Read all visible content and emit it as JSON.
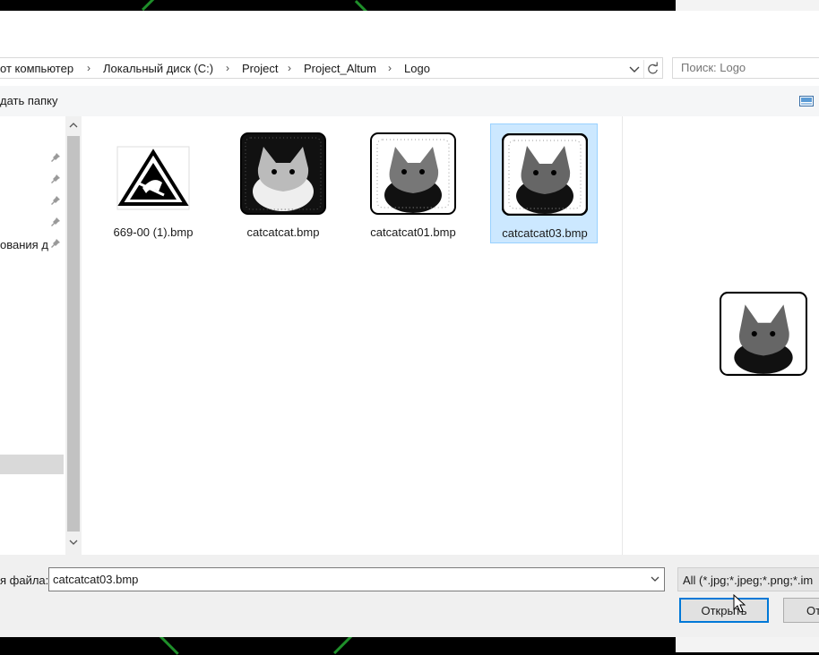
{
  "breadcrumb": {
    "items": [
      "от компьютер",
      "Локальный диск (C:)",
      "Project",
      "Project_Altum",
      "Logo"
    ]
  },
  "search": {
    "placeholder": "Поиск: Logo"
  },
  "toolbar": {
    "new_folder_label": "дать папку"
  },
  "nav": {
    "visible_label": "ования д"
  },
  "files": [
    {
      "name": "669-00 (1).bmp",
      "selected": false
    },
    {
      "name": "catcatcat.bmp",
      "selected": false
    },
    {
      "name": "catcatcat01.bmp",
      "selected": false
    },
    {
      "name": "catcatcat03.bmp",
      "selected": true
    }
  ],
  "footer": {
    "filename_label": "я файла:",
    "filename_value": "catcatcat03.bmp",
    "filter_label": "All (*.jpg;*.jpeg;*.png;*.im",
    "open_button": "Открыть",
    "cancel_button": "От"
  },
  "colors": {
    "accent": "#0078d7",
    "selection_bg": "#cce8ff",
    "selection_border": "#99d1ff",
    "background_line": "#1f8f2a"
  }
}
